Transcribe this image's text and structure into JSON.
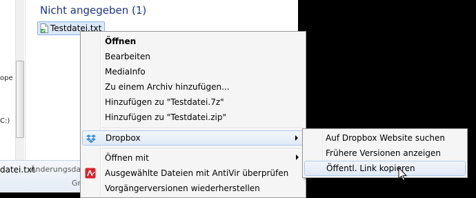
{
  "explorer": {
    "group_header": "Nicht angegeben (1)",
    "file_name": "Testdatei.txt",
    "nav_fragments": [
      "ope",
      "C:)"
    ],
    "details": {
      "file_name": "datei.txt",
      "label": "Änderungsdat",
      "fragment": "Gr"
    }
  },
  "context_menu": {
    "items": [
      {
        "label": "Öffnen",
        "bold": true
      },
      {
        "label": "Bearbeiten"
      },
      {
        "label": "MediaInfo"
      },
      {
        "label": "Zu einem Archiv hinzufügen..."
      },
      {
        "label": "Hinzufügen zu \"Testdatei.7z\""
      },
      {
        "label": "Hinzufügen zu \"Testdatei.zip\""
      },
      {
        "label": "Dropbox",
        "icon": "dropbox-icon",
        "submenu": true
      },
      {
        "label": "Öffnen mit",
        "submenu": true
      },
      {
        "label": "Ausgewählte Dateien mit AntiVir überprüfen",
        "icon": "antivir-icon"
      },
      {
        "label": "Vorgängerversionen wiederherstellen"
      }
    ]
  },
  "dropbox_submenu": {
    "items": [
      {
        "label": "Auf Dropbox Website suchen"
      },
      {
        "label": "Frühere Versionen anzeigen"
      },
      {
        "label": "Öffentl. Link kopieren",
        "highlighted": true
      }
    ]
  },
  "colors": {
    "group_header": "#1e3287",
    "selection_bg": "#dce8f7",
    "menu_bg": "#f5f5f5",
    "hover_border": "#aecbee",
    "antivir_red": "#d9252a",
    "dropbox_blue": "#3d8fd6"
  }
}
